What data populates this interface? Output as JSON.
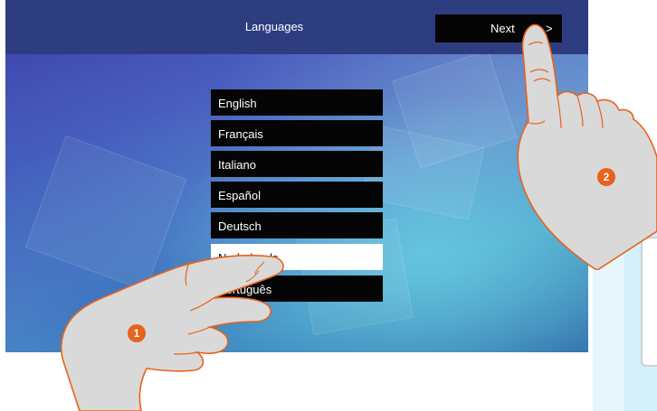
{
  "header": {
    "title": "Languages",
    "next_label": "Next",
    "next_arrow": ">"
  },
  "languages": [
    {
      "label": "English",
      "selected": false
    },
    {
      "label": "Français",
      "selected": false
    },
    {
      "label": "Italiano",
      "selected": false
    },
    {
      "label": "Español",
      "selected": false
    },
    {
      "label": "Deutsch",
      "selected": false
    },
    {
      "label": "Nederlands",
      "selected": true
    },
    {
      "label": "Português",
      "selected": false
    }
  ],
  "callouts": {
    "step_1": "1",
    "step_2": "2"
  },
  "colors": {
    "header_bg": "#2d3d80",
    "button_bg": "#050505",
    "selected_bg": "#ffffff",
    "callout": "#e8621c",
    "hand_fill": "#d9d9d9",
    "hand_outline": "#e8621c"
  }
}
